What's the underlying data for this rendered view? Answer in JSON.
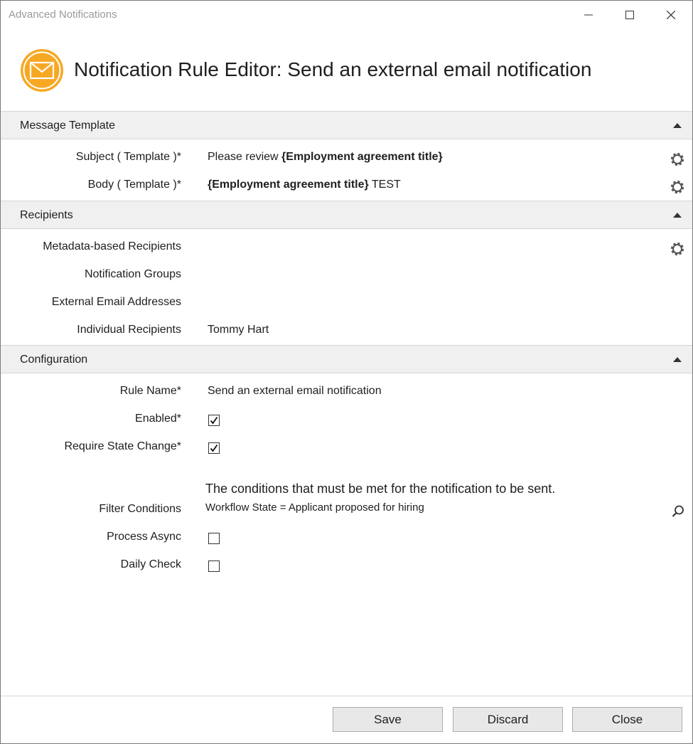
{
  "window": {
    "title": "Advanced Notifications",
    "controls": {
      "minimize": "minimize",
      "maximize": "maximize",
      "close": "close"
    }
  },
  "header": {
    "icon": "envelope-icon",
    "title": "Notification Rule Editor: Send an external email notification",
    "accent_color": "#f7a823"
  },
  "sections": {
    "message_template": {
      "title": "Message Template",
      "subject_label": "Subject ( Template )*",
      "subject_prefix": "Please review ",
      "subject_placeholder": "{Employment agreement title}",
      "body_label": "Body ( Template )*",
      "body_placeholder": "{Employment agreement title}",
      "body_suffix": " TEST"
    },
    "recipients": {
      "title": "Recipients",
      "metadata_label": "Metadata-based Recipients",
      "groups_label": "Notification Groups",
      "external_label": "External Email Addresses",
      "individual_label": "Individual Recipients",
      "individual_value": "Tommy Hart"
    },
    "configuration": {
      "title": "Configuration",
      "rule_name_label": "Rule Name*",
      "rule_name_value": "Send an external email notification",
      "enabled_label": "Enabled*",
      "enabled": true,
      "require_state_label": "Require State Change*",
      "require_state": true,
      "filter_label": "Filter Conditions",
      "filter_description": "The conditions that must be met for the notification to be sent.",
      "filter_value": "Workflow State = Applicant proposed for hiring",
      "process_async_label": "Process Async",
      "process_async": false,
      "daily_check_label": "Daily Check",
      "daily_check": false
    }
  },
  "footer": {
    "save_label": "Save",
    "discard_label": "Discard",
    "close_label": "Close"
  }
}
